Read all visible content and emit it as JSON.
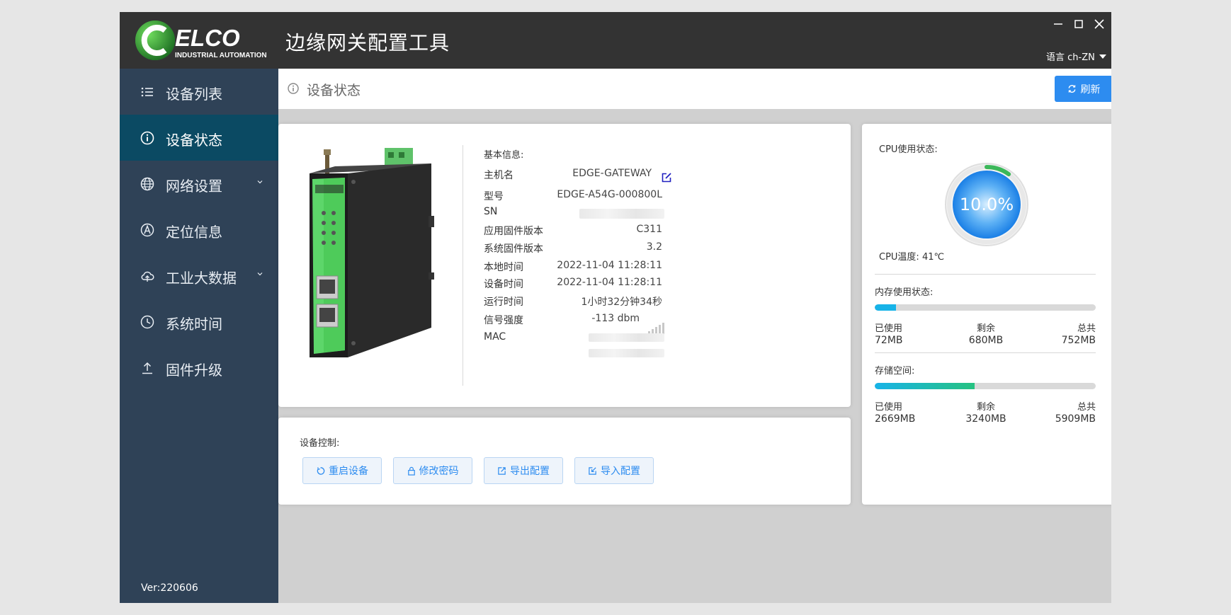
{
  "window": {
    "title": "边缘网关配置工具",
    "language": "语言 ch-ZN",
    "logo": {
      "brand": "ELCO",
      "tagline": "INDUSTRIAL AUTOMATION"
    }
  },
  "sidebar": {
    "items": [
      {
        "label": "设备列表",
        "icon": "list-icon",
        "active": false
      },
      {
        "label": "设备状态",
        "icon": "info-icon",
        "active": true
      },
      {
        "label": "网络设置",
        "icon": "globe-icon",
        "active": false
      },
      {
        "label": "定位信息",
        "icon": "location-icon",
        "active": false
      },
      {
        "label": "工业大数据",
        "icon": "cloud-icon",
        "active": false
      },
      {
        "label": "系统时间",
        "icon": "clock-icon",
        "active": false
      },
      {
        "label": "固件升级",
        "icon": "upload-icon",
        "active": false
      }
    ],
    "version": "Ver:220606"
  },
  "header": {
    "page_title": "设备状态",
    "refresh_label": "刷新"
  },
  "device_info": {
    "section_title": "基本信息:",
    "rows": [
      {
        "label": "主机名",
        "value": "EDGE-GATEWAY"
      },
      {
        "label": "型号",
        "value": "EDGE-A54G-000800L"
      },
      {
        "label": "SN",
        "value": ""
      },
      {
        "label": "应用固件版本",
        "value": "C311"
      },
      {
        "label": "系统固件版本",
        "value": "3.2"
      },
      {
        "label": "本地时间",
        "value": "2022-11-04 11:28:11"
      },
      {
        "label": "设备时间",
        "value": "2022-11-04 11:28:11"
      },
      {
        "label": "运行时间",
        "value": "1小时32分钟34秒"
      },
      {
        "label": "信号强度",
        "value": "-113 dbm"
      },
      {
        "label": "MAC",
        "value": ""
      }
    ]
  },
  "device_control": {
    "section_title": "设备控制:",
    "buttons": [
      {
        "label": "重启设备",
        "icon": "restart-icon"
      },
      {
        "label": "修改密码",
        "icon": "lock-icon"
      },
      {
        "label": "导出配置",
        "icon": "export-icon"
      },
      {
        "label": "导入配置",
        "icon": "import-icon"
      }
    ]
  },
  "status": {
    "cpu_title": "CPU使用状态:",
    "cpu_usage": "10.0%",
    "cpu_usage_fraction": 0.1,
    "cpu_temp": "CPU温度:  41℃",
    "memory": {
      "title": "内存使用状态:",
      "used_label": "已使用",
      "free_label": "剩余",
      "total_label": "总共",
      "used": "72MB",
      "free": "680MB",
      "total": "752MB",
      "used_fraction": 0.096
    },
    "storage": {
      "title": "存储空间:",
      "used_label": "已使用",
      "free_label": "剩余",
      "total_label": "总共",
      "used": "2669MB",
      "free": "3240MB",
      "total": "5909MB",
      "used_fraction": 0.452
    }
  },
  "colors": {
    "titlebar": "#333333",
    "sidebar": "#2f4257",
    "sidebar_active": "#0b4a63",
    "accent": "#2d8cf0",
    "memory_bar": "#17b3e8",
    "storage_bar_start": "#17b3e8",
    "storage_bar_end": "#26c281",
    "gauge_arc": "#3cb85a"
  }
}
